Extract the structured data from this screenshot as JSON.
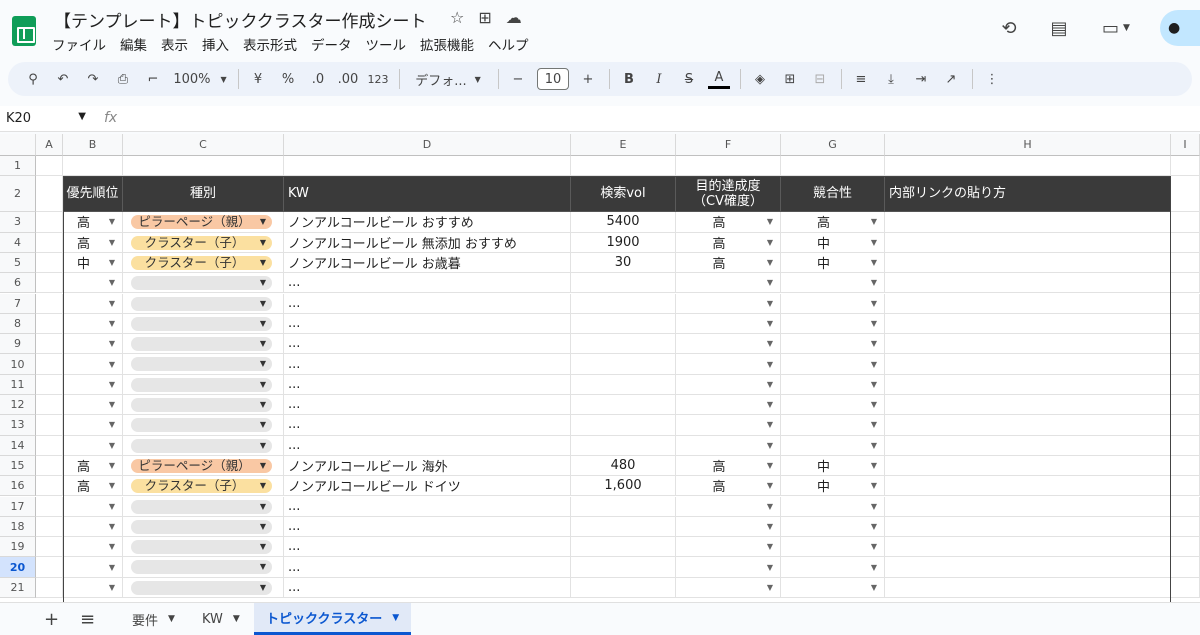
{
  "app": {
    "title": "【テンプレート】トピッククラスター作成シート",
    "menu": [
      "ファイル",
      "編集",
      "表示",
      "挿入",
      "表示形式",
      "データ",
      "ツール",
      "拡張機能",
      "ヘルプ"
    ]
  },
  "toolbar": {
    "zoom": "100%",
    "currency": "¥",
    "percent": "%",
    "dec_dec": ".0",
    "dec_inc": ".00",
    "format_num": "123",
    "font": "デフォ...",
    "font_size": "10",
    "bold": "B",
    "italic": "I",
    "strike": "S",
    "text_color": "A"
  },
  "formula": {
    "cell_ref": "K20",
    "fx": "fx"
  },
  "columns": [
    "A",
    "B",
    "C",
    "D",
    "E",
    "F",
    "G",
    "H",
    "I"
  ],
  "rows": [
    "1",
    "2",
    "3",
    "4",
    "5",
    "6",
    "7",
    "8",
    "9",
    "10",
    "11",
    "12",
    "13",
    "14",
    "15",
    "16",
    "17",
    "18",
    "19",
    "20",
    "21"
  ],
  "header": {
    "priority": "優先順位",
    "type": "種別",
    "kw": "KW",
    "vol": "検索vol",
    "goal_line1": "目的達成度",
    "goal_line2": "（CV確度）",
    "competition": "競合性",
    "links": "内部リンクの貼り方"
  },
  "data_rows": [
    {
      "priority": "高",
      "type": "ピラーページ（親）",
      "chip": "parent",
      "kw": "ノンアルコールビール おすすめ",
      "vol": "5400",
      "goal": "高",
      "comp": "高"
    },
    {
      "priority": "高",
      "type": "クラスター（子）",
      "chip": "child",
      "kw": "ノンアルコールビール 無添加 おすすめ",
      "vol": "1900",
      "goal": "高",
      "comp": "中"
    },
    {
      "priority": "中",
      "type": "クラスター（子）",
      "chip": "child",
      "kw": "ノンアルコールビール お歳暮",
      "vol": "30",
      "goal": "高",
      "comp": "中"
    },
    {
      "priority": "",
      "type": "",
      "chip": "empty",
      "kw": "...",
      "vol": "",
      "goal": "",
      "comp": ""
    },
    {
      "priority": "",
      "type": "",
      "chip": "empty",
      "kw": "...",
      "vol": "",
      "goal": "",
      "comp": ""
    },
    {
      "priority": "",
      "type": "",
      "chip": "empty",
      "kw": "...",
      "vol": "",
      "goal": "",
      "comp": ""
    },
    {
      "priority": "",
      "type": "",
      "chip": "empty",
      "kw": "...",
      "vol": "",
      "goal": "",
      "comp": ""
    },
    {
      "priority": "",
      "type": "",
      "chip": "empty",
      "kw": "...",
      "vol": "",
      "goal": "",
      "comp": ""
    },
    {
      "priority": "",
      "type": "",
      "chip": "empty",
      "kw": "...",
      "vol": "",
      "goal": "",
      "comp": ""
    },
    {
      "priority": "",
      "type": "",
      "chip": "empty",
      "kw": "...",
      "vol": "",
      "goal": "",
      "comp": ""
    },
    {
      "priority": "",
      "type": "",
      "chip": "empty",
      "kw": "...",
      "vol": "",
      "goal": "",
      "comp": ""
    },
    {
      "priority": "",
      "type": "",
      "chip": "empty",
      "kw": "...",
      "vol": "",
      "goal": "",
      "comp": ""
    },
    {
      "priority": "高",
      "type": "ピラーページ（親）",
      "chip": "parent",
      "kw": "ノンアルコールビール 海外",
      "vol": "480",
      "goal": "高",
      "comp": "中"
    },
    {
      "priority": "高",
      "type": "クラスター（子）",
      "chip": "child",
      "kw": "ノンアルコールビール ドイツ",
      "vol": "1,600",
      "goal": "高",
      "comp": "中"
    },
    {
      "priority": "",
      "type": "",
      "chip": "empty",
      "kw": "...",
      "vol": "",
      "goal": "",
      "comp": ""
    },
    {
      "priority": "",
      "type": "",
      "chip": "empty",
      "kw": "...",
      "vol": "",
      "goal": "",
      "comp": ""
    },
    {
      "priority": "",
      "type": "",
      "chip": "empty",
      "kw": "...",
      "vol": "",
      "goal": "",
      "comp": ""
    },
    {
      "priority": "",
      "type": "",
      "chip": "empty",
      "kw": "...",
      "vol": "",
      "goal": "",
      "comp": ""
    },
    {
      "priority": "",
      "type": "",
      "chip": "empty",
      "kw": "...",
      "vol": "",
      "goal": "",
      "comp": ""
    }
  ],
  "selected_row": "20",
  "sheets": [
    {
      "label": "要件",
      "active": false
    },
    {
      "label": "KW",
      "active": false
    },
    {
      "label": "トピッククラスター",
      "active": true
    }
  ]
}
